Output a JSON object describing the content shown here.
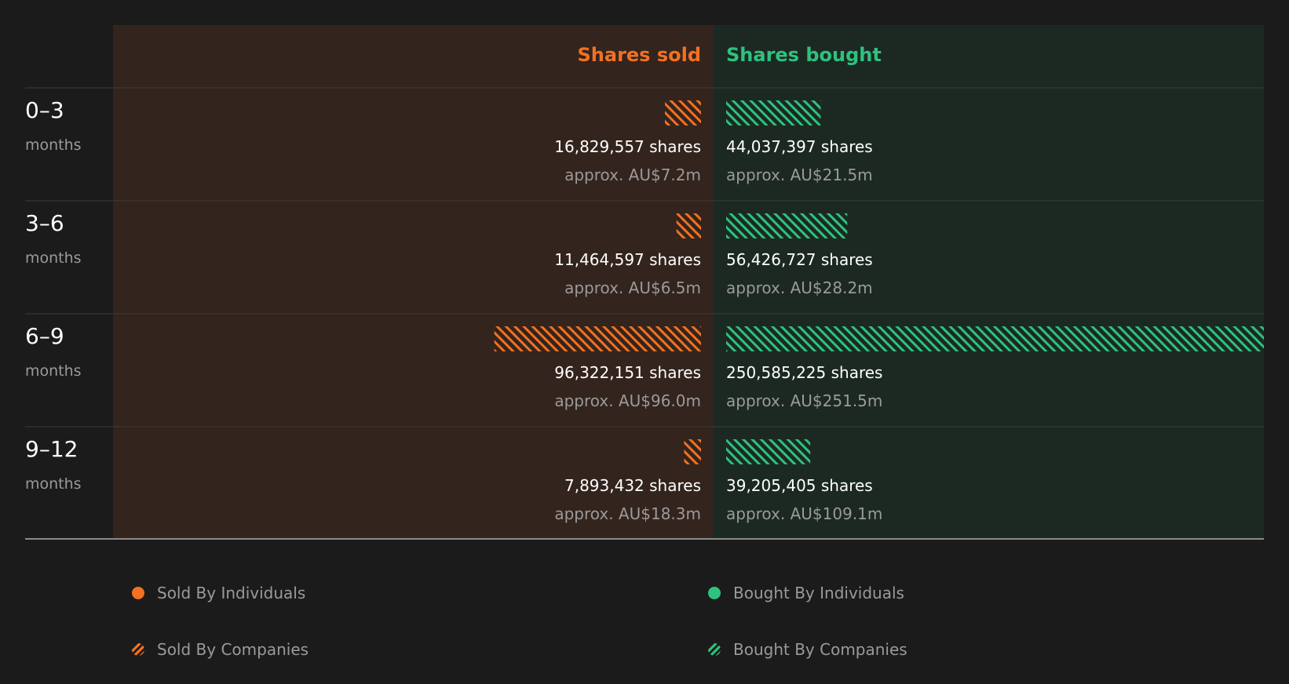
{
  "chart_data": {
    "type": "bar",
    "orientation": "horizontal-diverging",
    "headers": {
      "sold": "Shares sold",
      "bought": "Shares bought"
    },
    "unit_suffix": " shares",
    "periods": [
      {
        "label": "0–3",
        "unit": "months",
        "sold_shares": 16829557,
        "sold_shares_label": "16,829,557 shares",
        "sold_value_label": "approx. AU$7.2m",
        "bought_shares": 44037397,
        "bought_shares_label": "44,037,397 shares",
        "bought_value_label": "approx. AU$21.5m"
      },
      {
        "label": "3–6",
        "unit": "months",
        "sold_shares": 11464597,
        "sold_shares_label": "11,464,597 shares",
        "sold_value_label": "approx. AU$6.5m",
        "bought_shares": 56426727,
        "bought_shares_label": "56,426,727 shares",
        "bought_value_label": "approx. AU$28.2m"
      },
      {
        "label": "6–9",
        "unit": "months",
        "sold_shares": 96322151,
        "sold_shares_label": "96,322,151 shares",
        "sold_value_label": "approx. AU$96.0m",
        "bought_shares": 250585225,
        "bought_shares_label": "250,585,225 shares",
        "bought_value_label": "approx. AU$251.5m"
      },
      {
        "label": "9–12",
        "unit": "months",
        "sold_shares": 7893432,
        "sold_shares_label": "7,893,432 shares",
        "sold_value_label": "approx. AU$18.3m",
        "bought_shares": 39205405,
        "bought_shares_label": "39,205,405 shares",
        "bought_value_label": "approx. AU$109.1m"
      }
    ],
    "legend": [
      {
        "label": "Sold By Individuals",
        "marker": "solid-dot",
        "color": "#f37121"
      },
      {
        "label": "Sold By Companies",
        "marker": "hatched-dot",
        "color": "#f37121"
      },
      {
        "label": "Bought By Individuals",
        "marker": "solid-dot",
        "color": "#2ec27e"
      },
      {
        "label": "Bought By Companies",
        "marker": "hatched-dot",
        "color": "#2ec27e"
      }
    ],
    "colors": {
      "sold": "#f37121",
      "bought": "#2ec27e",
      "sold_panel": "#33241d",
      "bought_panel": "#1c2923",
      "background": "#1b1b1b"
    },
    "grid": false,
    "legend_position": "bottom"
  }
}
